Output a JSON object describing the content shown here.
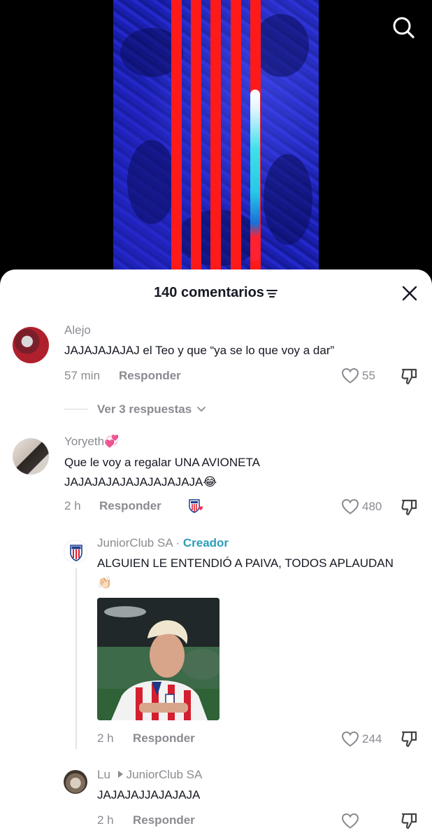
{
  "video": {
    "search_icon": "search-icon",
    "colors": {
      "stripe": "#ff1a1a",
      "crowd": "#1c20b8"
    }
  },
  "sheet": {
    "title": "140 comentarios",
    "sort_icon": "sort-lines-icon",
    "close_icon": "close-icon"
  },
  "comments": [
    {
      "user": "Alejo",
      "text": "JAJAJAJAJAJ el Teo y que “ya se lo que voy a dar”",
      "time": "57 min",
      "reply_label": "Responder",
      "likes": "55",
      "view_replies": "Ver 3 respuestas"
    },
    {
      "user": "Yoryeth💞",
      "text_line1": "Que le voy a regalar UNA AVIONETA",
      "text_line2": "JAJAJAJAJAJAJAJAJAJA😂",
      "time": "2 h",
      "reply_label": "Responder",
      "likes": "480"
    }
  ],
  "replies": [
    {
      "user": "JuniorClub SA",
      "separator": " · ",
      "creator_label": "Creador",
      "text": "ALGUIEN LE ENTENDIÓ A PAIVA, TODOS APLAUDAN",
      "emoji": "👏🏻",
      "time": "2 h",
      "reply_label": "Responder",
      "likes": "244"
    },
    {
      "user": "Lu",
      "reply_to": "JuniorClub SA",
      "text": "JAJAJAJJAJAJAJA",
      "time": "2 h",
      "reply_label": "Responder",
      "likes": ""
    }
  ]
}
